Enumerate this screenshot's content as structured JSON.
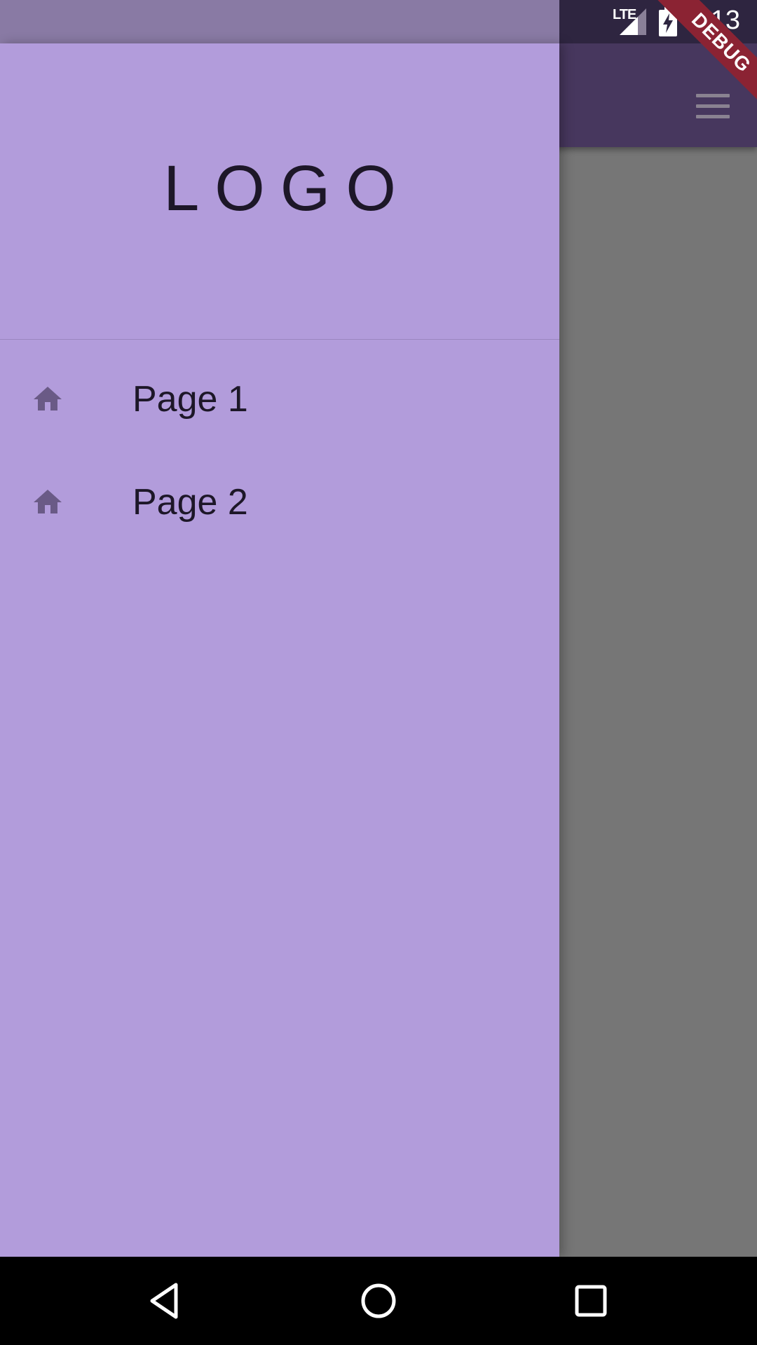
{
  "status_bar": {
    "network_label": "LTE",
    "time": "4:13",
    "icons": [
      "signal-icon",
      "battery-charging-icon"
    ]
  },
  "debug_ribbon": {
    "label": "DEBUG"
  },
  "app_bar": {
    "icons": [
      "menu-icon"
    ]
  },
  "drawer": {
    "header": {
      "logo": "LOGO"
    },
    "items": [
      {
        "label": "Page 1",
        "icon": "home-icon"
      },
      {
        "label": "Page 2",
        "icon": "home-icon"
      }
    ]
  },
  "nav_bar": {
    "icons": [
      "back-icon",
      "home-circle-icon",
      "recents-icon"
    ]
  },
  "colors": {
    "drawer_background": "#b29cdb",
    "app_bar": "#47375e",
    "scrim": "#767676",
    "text": "#1d1728",
    "icon": "#6a5a86",
    "debug_ribbon": "#8b2333"
  }
}
